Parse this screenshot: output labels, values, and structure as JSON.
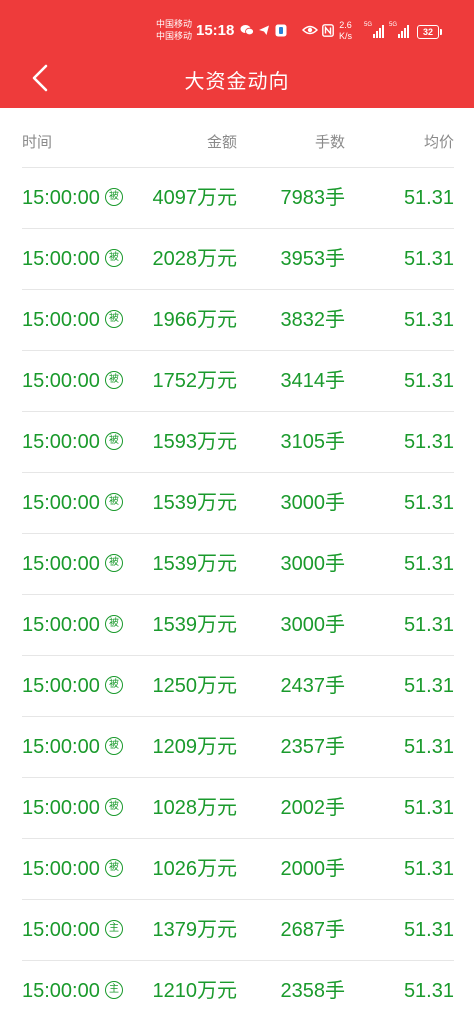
{
  "status_bar": {
    "carrier_1": "中国移动",
    "carrier_2": "中国移动",
    "time": "15:18",
    "net_speed_value": "2.6",
    "net_speed_unit": "K/s",
    "signal_1_tag": "5G",
    "signal_2_tag": "5G",
    "battery": "32",
    "icons": [
      "wechat-icon",
      "telegram-icon",
      "app-icon",
      "eye-icon",
      "nfc-icon"
    ]
  },
  "header": {
    "title": "大资金动向",
    "back_icon": "chevron-left-icon"
  },
  "table": {
    "columns": {
      "time": "时间",
      "amount": "金额",
      "volume": "手数",
      "price": "均价"
    },
    "rows": [
      {
        "time": "15:00:00",
        "badge": "被",
        "amount": "4097万元",
        "volume": "7983手",
        "price": "51.31"
      },
      {
        "time": "15:00:00",
        "badge": "被",
        "amount": "2028万元",
        "volume": "3953手",
        "price": "51.31"
      },
      {
        "time": "15:00:00",
        "badge": "被",
        "amount": "1966万元",
        "volume": "3832手",
        "price": "51.31"
      },
      {
        "time": "15:00:00",
        "badge": "被",
        "amount": "1752万元",
        "volume": "3414手",
        "price": "51.31"
      },
      {
        "time": "15:00:00",
        "badge": "被",
        "amount": "1593万元",
        "volume": "3105手",
        "price": "51.31"
      },
      {
        "time": "15:00:00",
        "badge": "被",
        "amount": "1539万元",
        "volume": "3000手",
        "price": "51.31"
      },
      {
        "time": "15:00:00",
        "badge": "被",
        "amount": "1539万元",
        "volume": "3000手",
        "price": "51.31"
      },
      {
        "time": "15:00:00",
        "badge": "被",
        "amount": "1539万元",
        "volume": "3000手",
        "price": "51.31"
      },
      {
        "time": "15:00:00",
        "badge": "被",
        "amount": "1250万元",
        "volume": "2437手",
        "price": "51.31"
      },
      {
        "time": "15:00:00",
        "badge": "被",
        "amount": "1209万元",
        "volume": "2357手",
        "price": "51.31"
      },
      {
        "time": "15:00:00",
        "badge": "被",
        "amount": "1028万元",
        "volume": "2002手",
        "price": "51.31"
      },
      {
        "time": "15:00:00",
        "badge": "被",
        "amount": "1026万元",
        "volume": "2000手",
        "price": "51.31"
      },
      {
        "time": "15:00:00",
        "badge": "主",
        "amount": "1379万元",
        "volume": "2687手",
        "price": "51.31"
      },
      {
        "time": "15:00:00",
        "badge": "主",
        "amount": "1210万元",
        "volume": "2358手",
        "price": "51.31"
      }
    ]
  },
  "colors": {
    "header_bg": "#ee3b3b",
    "value_green": "#1a9a2c",
    "column_header_gray": "#8a8a8a"
  }
}
